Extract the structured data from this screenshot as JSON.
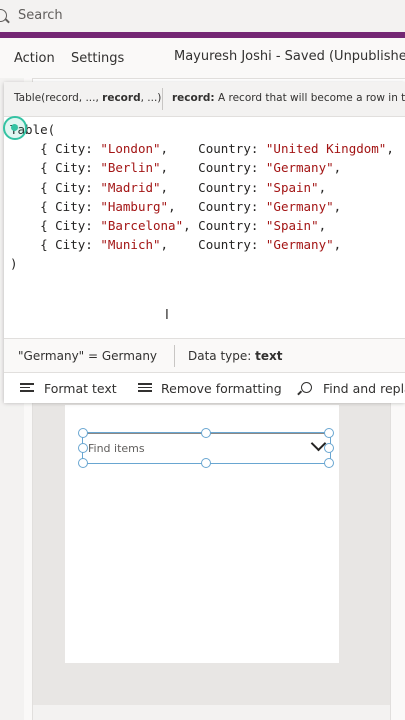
{
  "search": {
    "placeholder": "Search"
  },
  "menu": {
    "items": [
      {
        "label": "Action"
      },
      {
        "label": "Settings"
      }
    ],
    "status": "Mayuresh Joshi - Saved (Unpublished)"
  },
  "formula": {
    "signature_prefix": "Table(record, ..., ",
    "signature_bold": "record",
    "signature_suffix": ", ...)",
    "param_name": "record:",
    "param_desc": "A record that will become a row in t",
    "open": "Table(",
    "rows": [
      {
        "city": "\"London\"",
        "country": "\"United Kingdom\""
      },
      {
        "city": "\"Berlin\"",
        "country": "\"Germany\""
      },
      {
        "city": "\"Madrid\"",
        "country": "\"Spain\""
      },
      {
        "city": "\"Hamburg\"",
        "country": "\"Germany\""
      },
      {
        "city": "\"Barcelona\"",
        "country": "\"Spain\""
      },
      {
        "city": "\"Munich\"",
        "country": "\"Germany\""
      }
    ],
    "close": ")",
    "result_expr": "\"Germany\"  =  Germany",
    "datatype_label": "Data type:",
    "datatype_value": "text"
  },
  "format_toolbar": {
    "format_text": "Format text",
    "remove_formatting": "Remove formatting",
    "find_replace": "Find and repla"
  },
  "canvas": {
    "combo_placeholder": "Find items"
  },
  "colors": {
    "brand_band": "#742774",
    "string_literal": "#a31515",
    "selection": "#69a6d1",
    "caret_handle": "#33c3a3"
  }
}
